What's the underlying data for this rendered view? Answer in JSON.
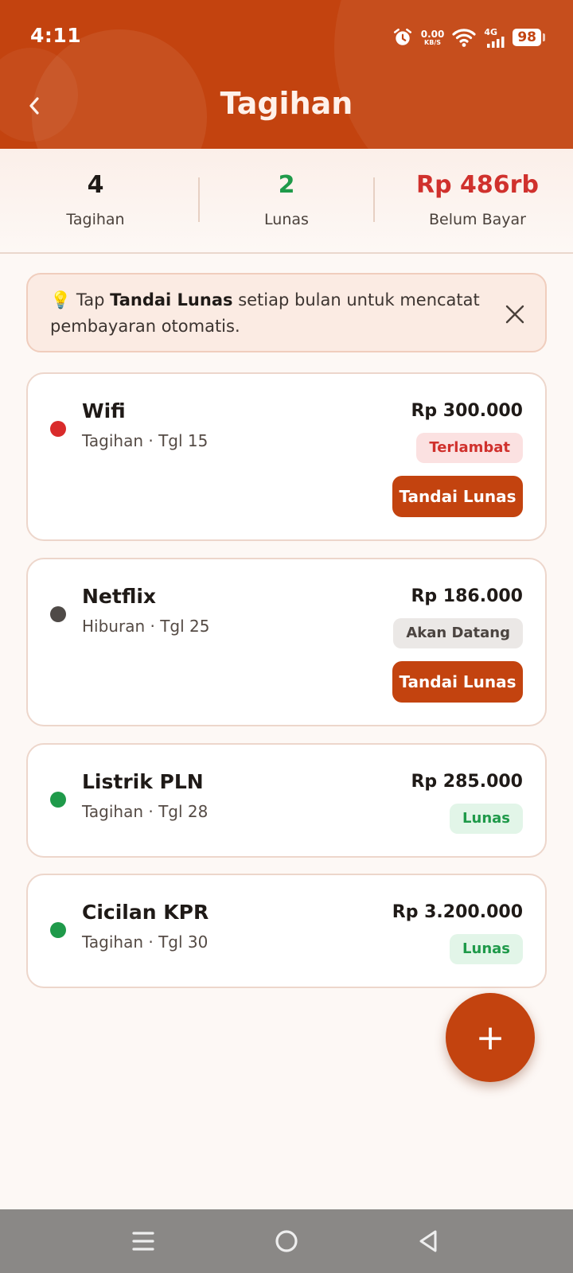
{
  "status_bar": {
    "time": "4:11",
    "speed_value": "0.00",
    "speed_unit": "KB/S",
    "network": "4G",
    "battery": "98"
  },
  "header": {
    "title": "Tagihan"
  },
  "summary": [
    {
      "value": "4",
      "label": "Tagihan",
      "color": "#1f1a17"
    },
    {
      "value": "2",
      "label": "Lunas",
      "color": "#1f9a4a"
    },
    {
      "value": "Rp 486rb",
      "label": "Belum Bayar",
      "color": "#d0312d"
    }
  ],
  "tip": {
    "icon": "lightbulb-icon",
    "emoji": "💡",
    "prefix": "Tap",
    "bold": "Tandai Lunas",
    "suffix": "setiap bulan untuk mencatat pembayaran otomatis."
  },
  "bills": [
    {
      "name": "Wifi",
      "subtitle": "Tagihan · Tgl 15",
      "amount": "Rp 300.000",
      "status": "Terlambat",
      "dot_color": "#d92b2b",
      "button": "Tandai Lunas"
    },
    {
      "name": "Netflix",
      "subtitle": "Hiburan · Tgl 25",
      "amount": "Rp 186.000",
      "status": "Akan Datang",
      "dot_color": "#4f4a47",
      "button": "Tandai Lunas"
    },
    {
      "name": "Listrik PLN",
      "subtitle": "Tagihan · Tgl 28",
      "amount": "Rp 285.000",
      "status": "Lunas",
      "dot_color": "#1f9a4a"
    },
    {
      "name": "Cicilan KPR",
      "subtitle": "Tagihan · Tgl 30",
      "amount": "Rp 3.200.000",
      "status": "Lunas",
      "dot_color": "#1f9a4a"
    }
  ],
  "fab": {
    "symbol": "+"
  },
  "colors": {
    "primary": "#c3430f",
    "background": "#fdf8f5"
  }
}
